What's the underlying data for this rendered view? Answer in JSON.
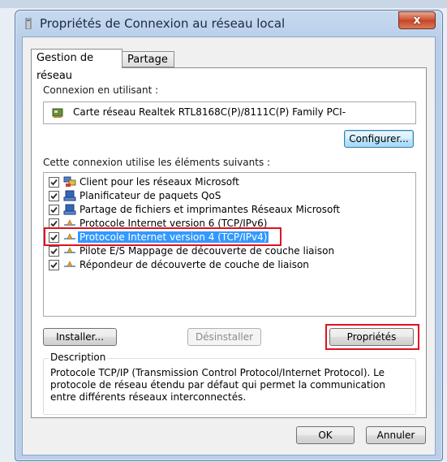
{
  "window": {
    "title": "Propriétés de Connexion au réseau local",
    "close_glyph": "x"
  },
  "tabs": [
    {
      "label": "Gestion de réseau",
      "active": true
    },
    {
      "label": "Partage",
      "active": false
    }
  ],
  "connection": {
    "label": "Connexion en utilisant :",
    "adapter": "Carte réseau Realtek RTL8168C(P)/8111C(P) Family PCI-",
    "configure_button": "Configurer..."
  },
  "items_label": "Cette connexion utilise les éléments suivants :",
  "items": [
    {
      "label": "Client pour les réseaux Microsoft",
      "checked": true,
      "icon": "network-client-icon",
      "selected": false
    },
    {
      "label": "Planificateur de paquets QoS",
      "checked": true,
      "icon": "network-service-icon",
      "selected": false
    },
    {
      "label": "Partage de fichiers et imprimantes Réseaux Microsoft",
      "checked": true,
      "icon": "network-service-icon",
      "selected": false
    },
    {
      "label": "Protocole Internet version 6 (TCP/IPv6)",
      "checked": true,
      "icon": "protocol-icon",
      "selected": false
    },
    {
      "label": "Protocole Internet version 4 (TCP/IPv4)",
      "checked": true,
      "icon": "protocol-icon",
      "selected": true
    },
    {
      "label": "Pilote E/S Mappage de découverte de couche liaison",
      "checked": true,
      "icon": "protocol-icon",
      "selected": false
    },
    {
      "label": "Répondeur de découverte de couche de liaison",
      "checked": true,
      "icon": "protocol-icon",
      "selected": false
    }
  ],
  "buttons": {
    "install": "Installer...",
    "uninstall": "Désinstaller",
    "properties": "Propriétés",
    "ok": "OK",
    "cancel": "Annuler"
  },
  "description": {
    "title": "Description",
    "text": "Protocole TCP/IP (Transmission Control Protocol/Internet Protocol). Le protocole de réseau étendu par défaut qui permet la communication entre différents réseaux interconnectés."
  },
  "colors": {
    "selection": "#3399ff",
    "highlight_box": "#e0121e",
    "title_bar": "#b9cfea"
  }
}
